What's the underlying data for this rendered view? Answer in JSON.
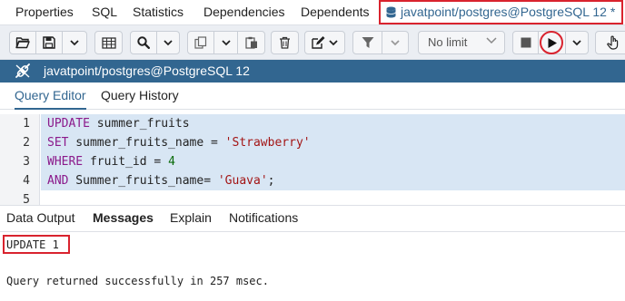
{
  "tabs": [
    "Properties",
    "SQL",
    "Statistics",
    "Dependencies",
    "Dependents"
  ],
  "active_tab": "javatpoint/postgres@PostgreSQL 12 *",
  "toolbar": {
    "limit_value": "No limit",
    "icons": [
      "open-folder",
      "save",
      "dropdown",
      "grid",
      "search",
      "dropdown",
      "copy",
      "dropdown",
      "paste",
      "trash",
      "edit",
      "dropdown",
      "filter",
      "dropdown",
      "stop",
      "execute",
      "dropdown",
      "hand"
    ]
  },
  "connection": {
    "label": "javatpoint/postgres@PostgreSQL 12"
  },
  "editor_tabs": [
    "Query Editor",
    "Query History"
  ],
  "code": {
    "line_numbers": [
      "1",
      "2",
      "3",
      "4",
      "5"
    ],
    "lines": [
      {
        "kw": "UPDATE",
        "rest": " summer_fruits"
      },
      {
        "kw": "SET",
        "rest": " summer_fruits_name = ",
        "str": "'Strawberry'"
      },
      {
        "kw": "WHERE",
        "rest": " fruit_id = ",
        "num": "4"
      },
      {
        "kw": "AND",
        "rest": " Summer_fruits_name= ",
        "str": "'Guava'",
        "tail": ";"
      }
    ]
  },
  "result_tabs": [
    "Data Output",
    "Messages",
    "Explain",
    "Notifications"
  ],
  "messages": {
    "status": "UPDATE 1",
    "detail": "Query returned successfully in 257 msec."
  },
  "colors": {
    "accent": "#326690",
    "highlight": "#d9232e",
    "keyword": "#8b1a8b",
    "string": "#a31515",
    "number": "#0a6b0a"
  }
}
